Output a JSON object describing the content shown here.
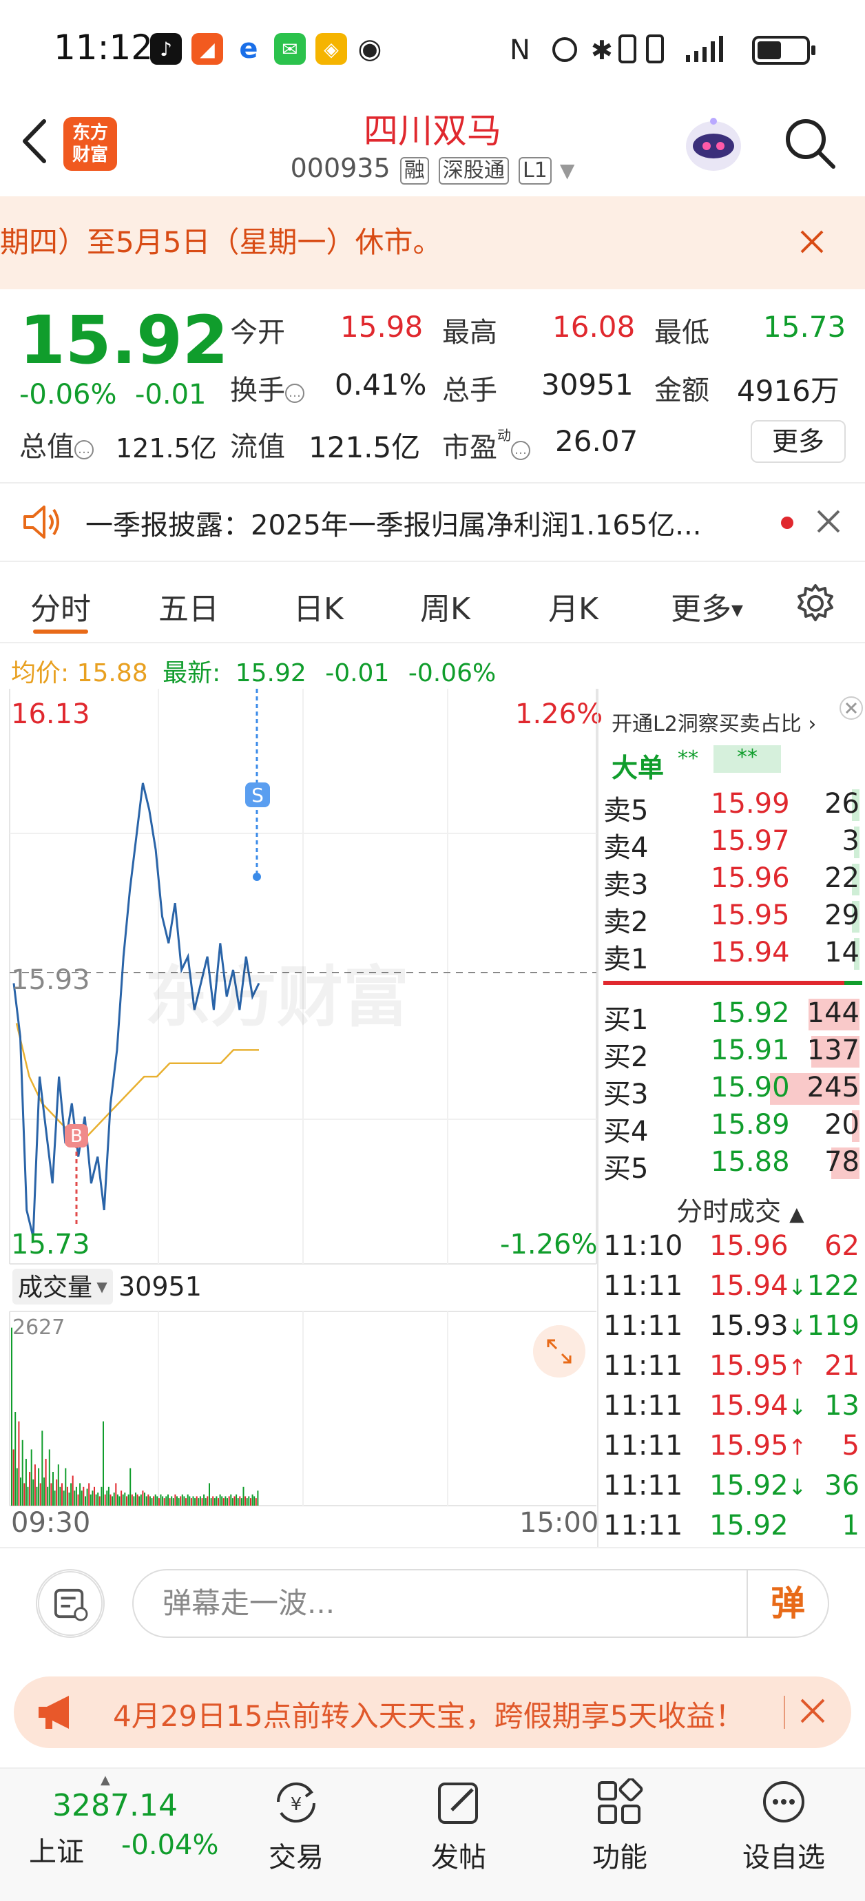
{
  "status_bar": {
    "time": "11:12",
    "right_icons": [
      "nfc-icon",
      "alarm-icon",
      "bluetooth-icon",
      "vibrate-icon",
      "signal-icon",
      "battery-icon"
    ]
  },
  "header": {
    "logo_text": "东方财富",
    "stock_name": "四川双马",
    "stock_code": "000935",
    "tags": [
      "融",
      "深股通",
      "L1"
    ]
  },
  "holiday_banner": {
    "text": "期四）至5月5日（星期一）休市。"
  },
  "quote": {
    "price": "15.92",
    "change_pct": "-0.06%",
    "change_abs": "-0.01",
    "open_label": "今开",
    "open": "15.98",
    "high_label": "最高",
    "high": "16.08",
    "low_label": "最低",
    "low": "15.73",
    "turnover_label": "换手",
    "turnover": "0.41%",
    "volume_label": "总手",
    "volume": "30951",
    "amount_label": "金额",
    "amount": "4916万",
    "mktcap_label": "总值",
    "mktcap": "121.5亿",
    "float_label": "流值",
    "float_cap": "121.5亿",
    "pe_label": "市盈",
    "pe_sup": "动",
    "pe": "26.07",
    "more_button": "更多"
  },
  "notice": {
    "text": "一季报披露：2025年一季报归属净利润1.165亿..."
  },
  "tabs": [
    "分时",
    "五日",
    "日K",
    "周K",
    "月K",
    "更多"
  ],
  "avg_line": {
    "avg_label": "均价:",
    "avg_value": "15.88",
    "latest_label": "最新:",
    "latest_value": "15.92",
    "chg": "-0.01",
    "pct": "-0.06%"
  },
  "chart_labels": {
    "price_high": "16.13",
    "pct_high": "1.26%",
    "price_mid": "15.93",
    "price_low": "15.73",
    "pct_low": "-1.26%",
    "watermark": "东方财富",
    "vol_label": "成交量",
    "vol_value": "30951",
    "vol_max": "2627",
    "time_start": "09:30",
    "time_end": "15:00",
    "marker_s": "S",
    "marker_b": "B"
  },
  "chart_data": {
    "type": "line",
    "y_range": [
      15.73,
      16.13
    ],
    "prev_close": 15.93,
    "series": [
      {
        "values": [
          15.93,
          15.89,
          15.76,
          15.74,
          15.86,
          15.82,
          15.78,
          15.86,
          15.81,
          15.84,
          15.8,
          15.83,
          15.78,
          15.8,
          15.76,
          15.84,
          15.88,
          15.95,
          16.0,
          16.04,
          16.08,
          16.06,
          16.03,
          15.98,
          15.96,
          15.99,
          15.94,
          15.95,
          15.91,
          15.93,
          15.95,
          15.91,
          15.96,
          15.92,
          15.94,
          15.91,
          15.95,
          15.92,
          15.93
        ]
      },
      {
        "values": [
          15.9,
          15.86,
          15.84,
          15.83,
          15.82,
          15.81,
          15.82,
          15.83,
          15.84,
          15.85,
          15.86,
          15.86,
          15.87,
          15.87,
          15.87,
          15.87,
          15.87,
          15.88,
          15.88,
          15.88
        ]
      }
    ],
    "volume_max": 2627
  },
  "l2_panel": {
    "link": "开通L2洞察买卖占比",
    "big_order_label": "大单",
    "big_order_v1": "**",
    "big_order_v2": "**"
  },
  "order_book": {
    "asks": [
      {
        "label": "卖5",
        "price": "15.99",
        "qty": "26",
        "bar": 0.03
      },
      {
        "label": "卖4",
        "price": "15.97",
        "qty": "3",
        "bar": 0.01
      },
      {
        "label": "卖3",
        "price": "15.96",
        "qty": "22",
        "bar": 0.03
      },
      {
        "label": "卖2",
        "price": "15.95",
        "qty": "29",
        "bar": 0.03
      },
      {
        "label": "卖1",
        "price": "15.94",
        "qty": "14",
        "bar": 0.02
      }
    ],
    "bids": [
      {
        "label": "买1",
        "price": "15.92",
        "qty": "144",
        "bar": 0.2
      },
      {
        "label": "买2",
        "price": "15.91",
        "qty": "137",
        "bar": 0.19
      },
      {
        "label": "买3",
        "price": "15.90",
        "qty": "245",
        "bar": 0.35
      },
      {
        "label": "买4",
        "price": "15.89",
        "qty": "20",
        "bar": 0.03
      },
      {
        "label": "买5",
        "price": "15.88",
        "qty": "78",
        "bar": 0.11
      }
    ]
  },
  "ticks": {
    "header": "分时成交",
    "rows": [
      {
        "time": "11:10",
        "price": "15.96",
        "dir": "",
        "vol": "62",
        "color": "red"
      },
      {
        "time": "11:11",
        "price": "15.94",
        "dir": "↓",
        "vol": "122",
        "color": "red"
      },
      {
        "time": "11:11",
        "price": "15.93",
        "dir": "↓",
        "vol": "119",
        "color": "black"
      },
      {
        "time": "11:11",
        "price": "15.95",
        "dir": "↑",
        "vol": "21",
        "color": "red"
      },
      {
        "time": "11:11",
        "price": "15.94",
        "dir": "↓",
        "vol": "13",
        "color": "red"
      },
      {
        "time": "11:11",
        "price": "15.95",
        "dir": "↑",
        "vol": "5",
        "color": "red"
      },
      {
        "time": "11:11",
        "price": "15.92",
        "dir": "↓",
        "vol": "36",
        "color": "green"
      },
      {
        "time": "11:11",
        "price": "15.92",
        "dir": "",
        "vol": "1",
        "color": "green"
      }
    ]
  },
  "comment": {
    "placeholder": "弹幕走一波...",
    "danmu": "弹"
  },
  "promo": {
    "text": "4月29日15点前转入天天宝，跨假期享5天收益！"
  },
  "bottom_nav": {
    "index_value": "3287.14",
    "index_name": "上证",
    "index_chg": "-0.04%",
    "items": [
      "交易",
      "发帖",
      "功能",
      "设自选"
    ]
  }
}
